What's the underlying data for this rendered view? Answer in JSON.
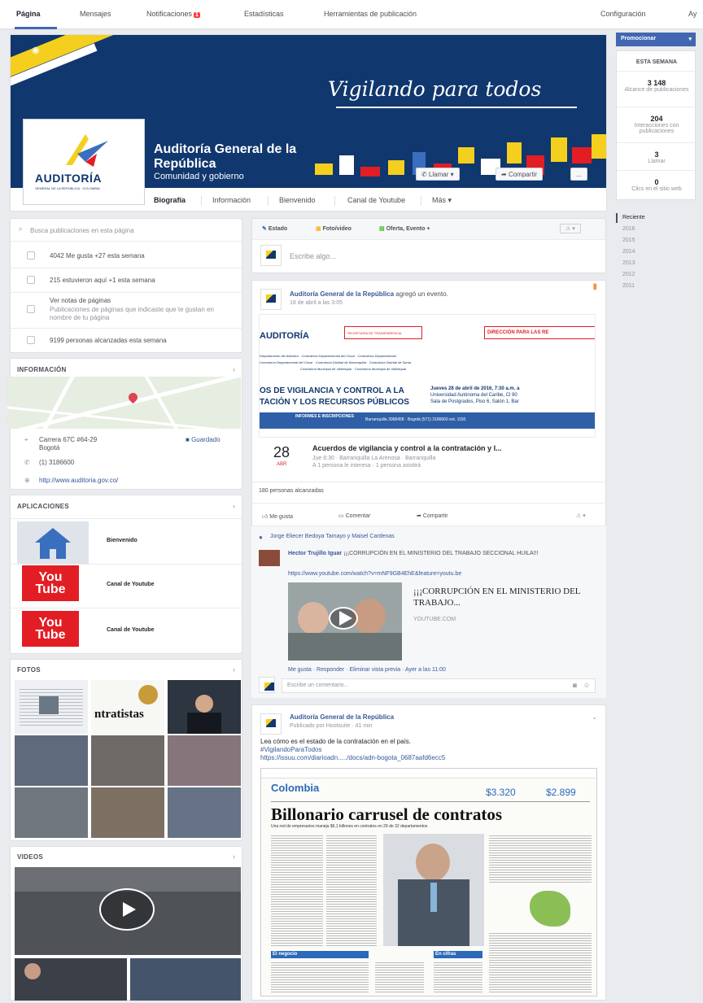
{
  "topnav": {
    "tabs": [
      "Página",
      "Mensajes",
      "Notificaciones",
      "Estadísticas",
      "Herramientas de publicación"
    ],
    "notification_badge": "1",
    "right": [
      "Configuración",
      "Ay"
    ]
  },
  "cover": {
    "slogan": "Vigilando para todos",
    "page_name": "Auditoría General de la República",
    "category": "Comunidad y gobierno",
    "logo_word": "AUDITORÍA",
    "logo_sub": "GENERAL DE LA REPÚBLICA · COLOMBIA",
    "call_button": "Llamar",
    "share_button": "Compartir",
    "more_button": "...",
    "tabs": [
      "Biografía",
      "Información",
      "Bienvenido",
      "Canal de Youtube",
      "Más"
    ]
  },
  "colors": {
    "facebook_blue": "#4267b2",
    "link": "#365899",
    "cover_navy": "#10376e",
    "cover_yellow": "#f4cf1d",
    "youtube_red": "#e31d24"
  },
  "left": {
    "search_placeholder": "Busca publicaciones en esta página",
    "stats": [
      {
        "icon": "thumb-icon",
        "text": "4042 Me gusta +27 esta semana"
      },
      {
        "icon": "check-icon",
        "text": "215 estuvieron aquí +1 esta semana"
      },
      {
        "icon": "flag-icon",
        "text": "Ver notas de páginas",
        "sub": "Publicaciones de páginas que indicaste que te gustan en nombre de tu página"
      },
      {
        "icon": "chart-icon",
        "text": "9199 personas alcanzadas esta semana"
      }
    ],
    "info_title": "INFORMACIÓN",
    "address": "Carrera 67C #64-29",
    "city": "Bogotá",
    "save_label": "Guardado",
    "phone": "(1) 3186600",
    "website": "http://www.auditoria.gov.co/",
    "apps_title": "APLICACIONES",
    "apps": [
      "Bienvenido",
      "Canal de Youtube",
      "Canal de Youtube"
    ],
    "youtube_you": "You",
    "youtube_tube": "Tube",
    "photos_title": "FOTOS",
    "photo_caption": "ntratistas",
    "videos_title": "VIDEOS"
  },
  "composer": {
    "status": "Estado",
    "photo": "Foto/video",
    "offer": "Oferta, Evento +",
    "placeholder": "Escribe algo..."
  },
  "post1": {
    "author": "Auditoría General de la República",
    "action": "agregó un evento.",
    "time": "18 de abril a las 3:05",
    "banner_logo": "AUDITORÍA",
    "banner_left_tag": "SECRETARÍA DE TRANSPARENCIA",
    "banner_right_tag": "DIRECCIÓN PARA LAS RE",
    "banner_entities_1": "Departamento del Atlántico · Contraloría Departamental del Cesar · Contraloría Departamental",
    "banner_entities_2": "Contraloría Departamental del Cesar · Contraloría Distrital de Barranquilla · Contraloría Distrital de Santa",
    "banner_entities_3": "Contraloría Municipal de Valledupar · Contraloría Municipal de Valledupar",
    "banner_title_1": "OS DE VIGILANCIA Y CONTROL A LA",
    "banner_title_2": "TACIÓN Y LOS RECURSOS PÚBLICOS",
    "banner_date": "Jueves 28 de abril de 2016, 7:30 a.m. a",
    "banner_place": "Universidad Autónoma del Caribe, Cl 90",
    "banner_room": "Sala de Postgrados, Piso 6, Salón 1, Bar",
    "banner_info_label": "INFORMES E INSCRIPCIONES",
    "banner_info_text": "Barranquilla 3068458 · Bogotá (571) 3186600 ext. 1150",
    "event_day": "28",
    "event_month": "ABR",
    "event_title": "Acuerdos de vigilancia y control a la contratación y l...",
    "event_when": "Jue 8:30 · Barranquilla La Arenosa · Barranquilla",
    "event_going": "A 1 persona le interesa · 1 persona asistirá",
    "reach": "180 personas alcanzadas",
    "actions": [
      "Me gusta",
      "Comentar",
      "Compartir"
    ],
    "likers": "Jorge Eliecer Bedoya Tamayo y Maisel Cardenas",
    "commenter": "Hector Trujillo Iguar",
    "comment_text": "¡¡¡CORRUPCIÓN EN EL MINISTERIO DEL TRABAJO SECCIONAL HUILA!!!",
    "comment_link": "https://www.youtube.com/watch?v=mNF9GB4EhE&feature=youtu.be",
    "preview_title": "¡¡¡CORRUPCIÓN EN EL MINISTERIO DEL TRABAJO...",
    "preview_source": "YOUTUBE.COM",
    "comment_actions": "Me gusta · Responder · Eliminar vista previa · Ayer a las 11:00",
    "comment_placeholder": "Escribe un comentario..."
  },
  "post2": {
    "author": "Auditoría General de la República",
    "meta": "Publicado por Hootsuite · 41 min",
    "text": "Lea cómo es el estado de la contratación en el país.",
    "hashtag": "#VigilandoParaTodos",
    "link": "https://issuu.com/diarioadn...../docs/adn-bogota_0687aafd6ecc5",
    "article_section": "Colombia",
    "article_price_1": "$3.320",
    "article_price_2": "$2.899",
    "article_headline": "Billonario carrusel de contratos",
    "article_lead": "Una red de empresarios maneja $6,1 billones en contratos en 29 de 32 departamentos",
    "article_box_1": "El negocio",
    "article_box_2": "En cifras"
  },
  "right": {
    "promote": "Promocionar",
    "week_title": "ESTA SEMANA",
    "stats": [
      {
        "value": "3 148",
        "label": "Alcance de publicaciones"
      },
      {
        "value": "204",
        "label": "Interacciones con publicaciones"
      },
      {
        "value": "3",
        "label": "Llamar"
      },
      {
        "value": "0",
        "label": "Clics en el sitio web"
      }
    ],
    "timeline": [
      "Reciente",
      "2016",
      "2015",
      "2014",
      "2013",
      "2012",
      "2011"
    ]
  }
}
